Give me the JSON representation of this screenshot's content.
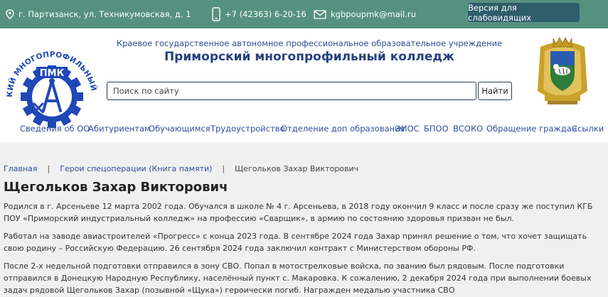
{
  "topbar": {
    "address": "г. Партизанск, ул. Техникумовская, д. 1",
    "phone": "+7 (42363) 6-20-16",
    "email": "kgbpoupmk@mail.ru",
    "vision_button": "Версия для слабовидящих"
  },
  "header": {
    "subtitle": "Краевое государственное автономное профессиональное образовательное учреждение",
    "title": "Приморский многопрофильный колледж",
    "logo_text": "ПРИМОРСКИЙ МНОГОПРОФИЛЬНЫЙ КОЛЛЕДЖ",
    "logo_abbr": "ПМК",
    "search": {
      "placeholder": "Поиск по сайту",
      "button": "Найти"
    }
  },
  "nav": {
    "items": [
      "Сведения об ОО",
      "Абитуриентам",
      "Обучающимся",
      "Трудоустройство",
      "Отделение доп образования",
      "ЭИОС",
      "БПОО",
      "ВСОКО",
      "Обращение граждан",
      "Ссылки"
    ]
  },
  "breadcrumbs": {
    "home": "Главная",
    "section": "Герои спецоперации (Книга памяти)",
    "current": "Щегольков Захар Викторович",
    "separator": "|"
  },
  "article": {
    "title": "Щегольков Захар Викторович",
    "paragraphs": [
      "Родился в г. Арсеньеве 12 марта 2002 года. Обучался в школе № 4 г. Арсеньева, в 2018 году окончил 9 класс и после сразу же поступил КГБ ПОУ «Приморский индустриальный колледж» на профессию «Сварщик», в армию по состоянию здоровья призван не был.",
      "Работал на заводе авиастроителей «Прогресс» с конца 2023 года. В сентябре 2024 года Захар принял решение о том, что хочет защищать свою родину – Российскую Федерацию. 26 сентября 2024 года заключил контракт с Министерством обороны РФ.",
      "После 2-х недельной подготовки отправился в зону СВО. Попал в мотострелковые войска, по званию был рядовым. После подготовки отправился в Донецкую Народную Республику, населённый пункт с. Макаровка. К сожалению, 2 декабря 2024 года при выполнении боевых задач рядовой Щегольков Захар (позывной «Щука») героически погиб. Награжден медалью участника СВО"
    ]
  },
  "colors": {
    "topbar": "#56917f",
    "vision_button": "#2e5d6b",
    "link": "#2c4f9e",
    "title": "#24417f",
    "content_bg": "#f0f0f0",
    "logo_blue": "#1f47b8"
  },
  "icons": [
    "location-icon",
    "phone-icon",
    "mail-icon"
  ]
}
